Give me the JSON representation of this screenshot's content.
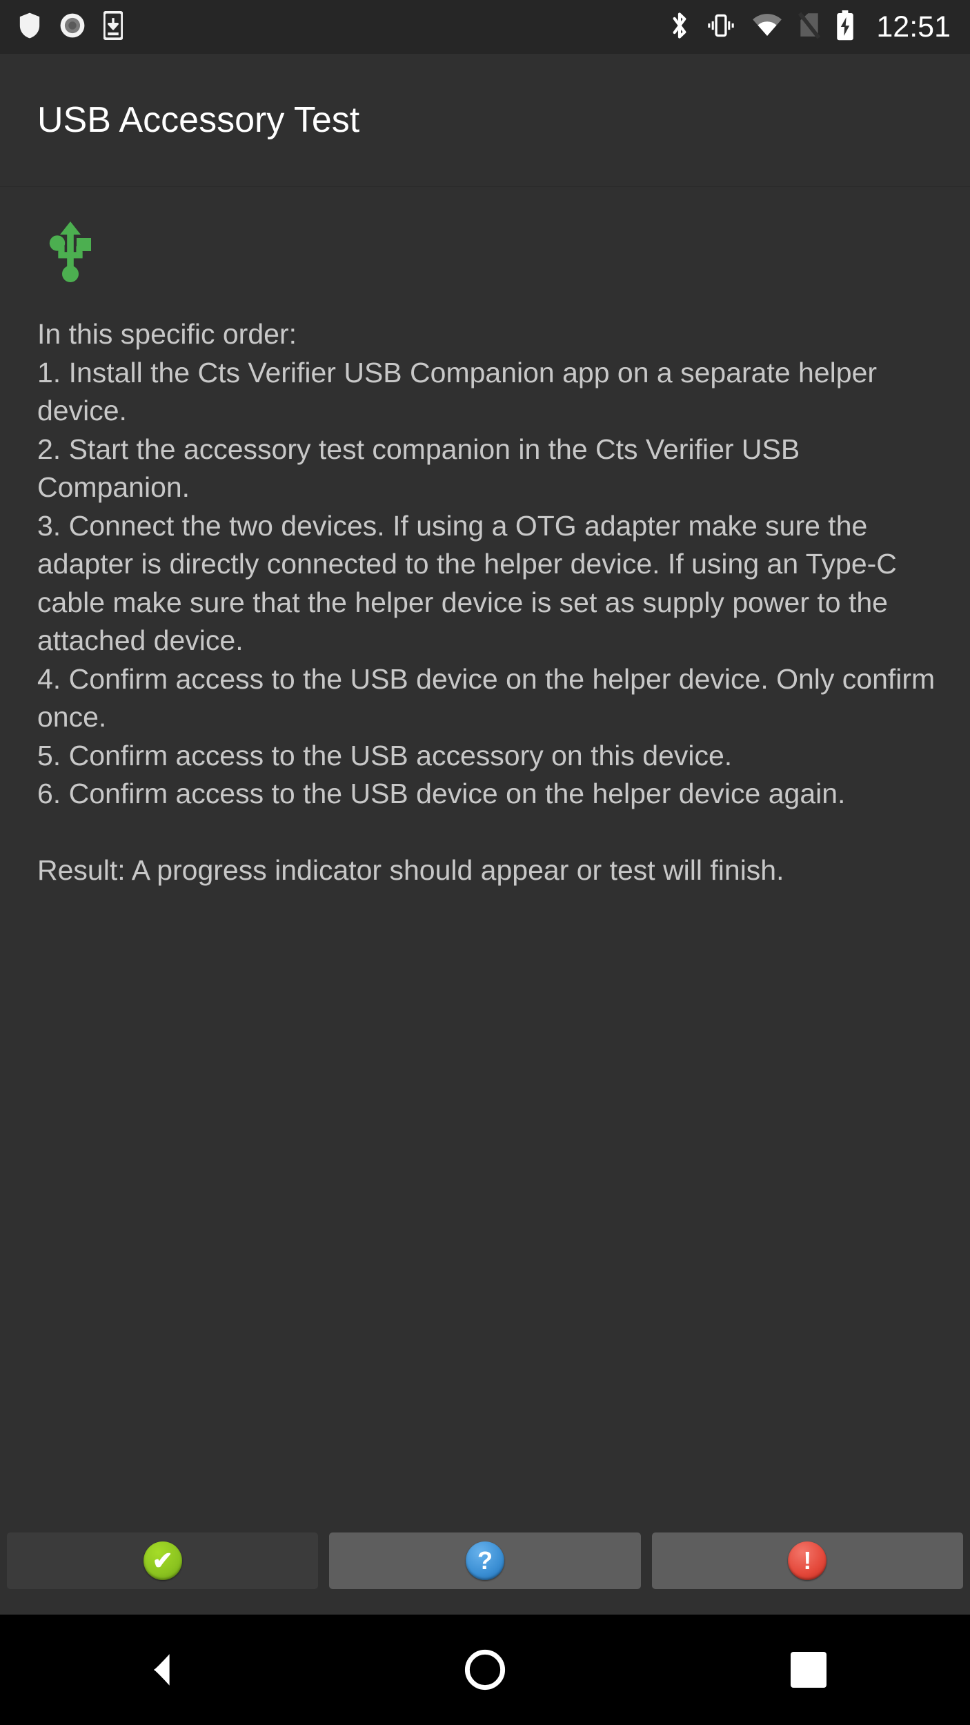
{
  "status_bar": {
    "left_icons": [
      {
        "name": "shield-icon",
        "label": "shield"
      },
      {
        "name": "record-circle-icon",
        "label": "screen recording"
      },
      {
        "name": "device-download-icon",
        "label": "download to device"
      }
    ],
    "right_icons": [
      {
        "name": "bluetooth-icon",
        "label": "Bluetooth"
      },
      {
        "name": "vibrate-icon",
        "label": "Vibrate mode"
      },
      {
        "name": "wifi-icon",
        "label": "Wi-Fi"
      },
      {
        "name": "no-sim-icon",
        "label": "No SIM"
      },
      {
        "name": "battery-charging-icon",
        "label": "Battery charging"
      }
    ],
    "clock": "12:51"
  },
  "action_bar": {
    "title": "USB Accessory Test"
  },
  "content": {
    "test_icon": {
      "name": "usb-icon",
      "color": "#4caf50"
    },
    "instructions": "In this specific order:\n1. Install the Cts Verifier USB Companion app on a separate helper device.\n2. Start the accessory test companion in the Cts Verifier USB Companion.\n3. Connect the two devices. If using a OTG adapter make sure the adapter is directly connected to the helper device. If using an Type-C cable make sure that the helper device is set as supply power to the attached device.\n4. Confirm access to the USB device on the helper device. Only confirm once.\n5. Confirm access to the USB accessory on this device.\n6. Confirm access to the USB device on the helper device again.\n\nResult: A progress indicator should appear or test will finish."
  },
  "button_bar": {
    "buttons": [
      {
        "name": "pass-button",
        "glyph": "✔",
        "style": "green",
        "label": "Pass"
      },
      {
        "name": "info-button",
        "glyph": "?",
        "style": "blue",
        "label": "Info"
      },
      {
        "name": "fail-button",
        "glyph": "!",
        "style": "red",
        "label": "Fail"
      }
    ]
  },
  "nav_bar": {
    "back": "Back",
    "home": "Home",
    "recents": "Recents"
  },
  "colors": {
    "background": "#303030",
    "status_bar": "#262626",
    "nav_bar": "#000000",
    "text": "#c8c8c8",
    "title_text": "#ffffff",
    "accent_green": "#4caf50",
    "pass_green": "#8cc420",
    "info_blue": "#3b8fd4",
    "fail_red": "#e4483a"
  }
}
